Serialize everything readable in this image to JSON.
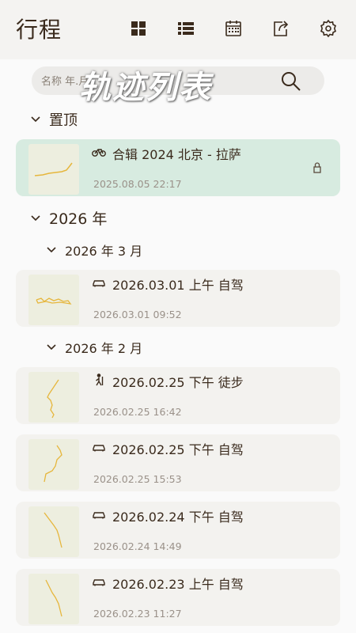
{
  "app": {
    "title": "行程",
    "overlay_title": "轨迹列表"
  },
  "toolbar": {
    "icons": [
      "grid-view-icon",
      "list-view-icon",
      "calendar-icon",
      "export-icon",
      "settings-icon"
    ]
  },
  "search": {
    "placeholder": "名称 年.月.日"
  },
  "sections": {
    "pinned": "置顶",
    "year_2026": "2026 年",
    "month_mar": "2026 年 3 月",
    "month_feb": "2026 年 2 月"
  },
  "tracks": [
    {
      "title": "合辑  2024 北京 - 拉萨",
      "date": "2025.08.05 22:17",
      "type": "bicycle",
      "pinned": true,
      "locked": true
    },
    {
      "title": "2026.03.01 上午 自驾",
      "date": "2026.03.01 09:52",
      "type": "car"
    },
    {
      "title": "2026.02.25 下午 徒步",
      "date": "2026.02.25 16:42",
      "type": "hiking"
    },
    {
      "title": "2026.02.25 下午 自驾",
      "date": "2026.02.25 15:53",
      "type": "car"
    },
    {
      "title": "2026.02.24 下午 自驾",
      "date": "2026.02.24 14:49",
      "type": "car"
    },
    {
      "title": "2026.02.23 上午 自驾",
      "date": "2026.02.23 11:27",
      "type": "car"
    }
  ],
  "colors": {
    "pinned_bg": "#d7ebe0",
    "card_bg": "#f3f2ef",
    "track": "#e6b63c",
    "text": "#3a2a1c"
  }
}
